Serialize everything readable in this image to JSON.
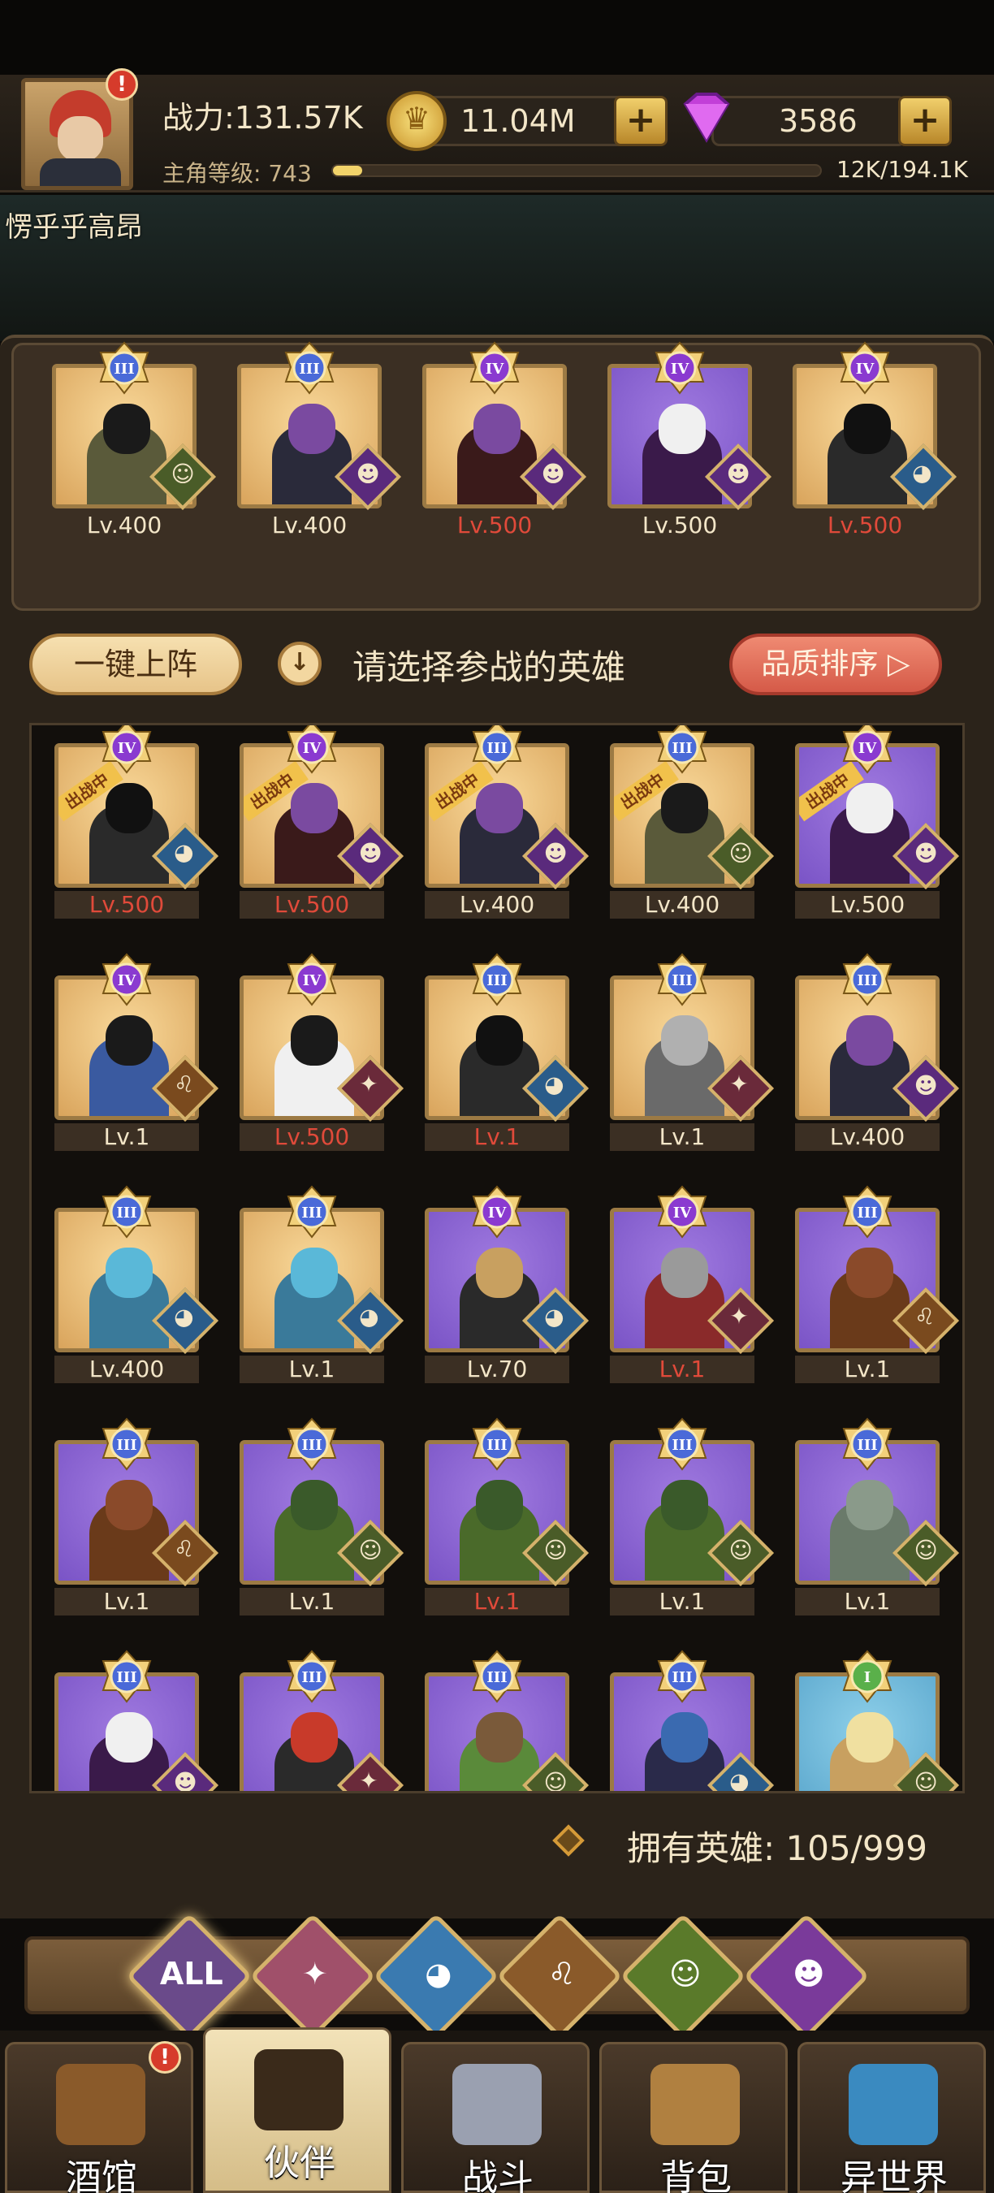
{
  "header": {
    "power_label": "战力:131.57K",
    "level_label": "主角等级:",
    "level_value": "743",
    "level_progress": 0.06,
    "exp_text": "12K/194.1K",
    "gold": "11.04M",
    "gems": "3586",
    "alert_badge": "!",
    "player_name": "愣乎乎高昂"
  },
  "team": [
    {
      "rank": "III",
      "level": "Lv.400",
      "level_red": false,
      "bg": "gold",
      "skin": "#1a1a1a",
      "body": "#5a5a3a",
      "faction": "el",
      "faction_icon": "☺"
    },
    {
      "rank": "III",
      "level": "Lv.400",
      "level_red": false,
      "bg": "gold",
      "skin": "#7a4aa0",
      "body": "#2a2a3a",
      "faction": "demon",
      "faction_icon": "☻"
    },
    {
      "rank": "IV",
      "level": "Lv.500",
      "level_red": true,
      "bg": "gold",
      "skin": "#7a4aa0",
      "body": "#3a1a1a",
      "faction": "demon",
      "faction_icon": "☻"
    },
    {
      "rank": "IV",
      "level": "Lv.500",
      "level_red": false,
      "bg": "purple",
      "skin": "#f0f0f0",
      "body": "#3a1a4a",
      "faction": "demon",
      "faction_icon": "☻"
    },
    {
      "rank": "IV",
      "level": "Lv.500",
      "level_red": true,
      "bg": "gold",
      "skin": "#111111",
      "body": "#2a2a2a",
      "faction": "fish",
      "faction_icon": "◕"
    }
  ],
  "controls": {
    "oneclick_label": "一键上阵",
    "info_icon": "↓",
    "prompt": "请选择参战的英雄",
    "sort_label": "品质排序 ▷"
  },
  "heroes": [
    {
      "rank": "IV",
      "level": "Lv.500",
      "level_red": true,
      "bg": "gold",
      "skin": "#111111",
      "body": "#2a2a2a",
      "faction": "fish",
      "faction_icon": "◕",
      "tag": "出战中"
    },
    {
      "rank": "IV",
      "level": "Lv.500",
      "level_red": true,
      "bg": "gold",
      "skin": "#7a4aa0",
      "body": "#3a1a1a",
      "faction": "demon",
      "faction_icon": "☻",
      "tag": "出战中"
    },
    {
      "rank": "III",
      "level": "Lv.400",
      "level_red": false,
      "bg": "gold",
      "skin": "#7a4aa0",
      "body": "#2a2a3a",
      "faction": "demon",
      "faction_icon": "☻",
      "tag": "出战中"
    },
    {
      "rank": "III",
      "level": "Lv.400",
      "level_red": false,
      "bg": "gold",
      "skin": "#1a1a1a",
      "body": "#5a5a3a",
      "faction": "el",
      "faction_icon": "☺",
      "tag": "出战中"
    },
    {
      "rank": "IV",
      "level": "Lv.500",
      "level_red": false,
      "bg": "purple",
      "skin": "#f0f0f0",
      "body": "#3a1a4a",
      "faction": "demon",
      "faction_icon": "☻",
      "tag": "出战中"
    },
    {
      "rank": "IV",
      "level": "Lv.1",
      "level_red": false,
      "bg": "gold",
      "skin": "#1a1a1a",
      "body": "#3a5aa0",
      "faction": "cat",
      "faction_icon": "♌",
      "tag": ""
    },
    {
      "rank": "IV",
      "level": "Lv.500",
      "level_red": true,
      "bg": "gold",
      "skin": "#1a1a1a",
      "body": "#f0f0f0",
      "faction": "cross",
      "faction_icon": "✦",
      "tag": ""
    },
    {
      "rank": "III",
      "level": "Lv.1",
      "level_red": true,
      "bg": "gold",
      "skin": "#111111",
      "body": "#2a2a2a",
      "faction": "fish",
      "faction_icon": "◕",
      "tag": ""
    },
    {
      "rank": "III",
      "level": "Lv.1",
      "level_red": false,
      "bg": "gold",
      "skin": "#b0b0b0",
      "body": "#6a6a6a",
      "faction": "cross",
      "faction_icon": "✦",
      "tag": ""
    },
    {
      "rank": "III",
      "level": "Lv.400",
      "level_red": false,
      "bg": "gold",
      "skin": "#7a4aa0",
      "body": "#2a2a3a",
      "faction": "demon",
      "faction_icon": "☻",
      "tag": ""
    },
    {
      "rank": "III",
      "level": "Lv.400",
      "level_red": false,
      "bg": "gold",
      "skin": "#5ab8d8",
      "body": "#3a7a9a",
      "faction": "fish",
      "faction_icon": "◕",
      "tag": ""
    },
    {
      "rank": "III",
      "level": "Lv.1",
      "level_red": false,
      "bg": "gold",
      "skin": "#5ab8d8",
      "body": "#3a7a9a",
      "faction": "fish",
      "faction_icon": "◕",
      "tag": ""
    },
    {
      "rank": "IV",
      "level": "Lv.70",
      "level_red": false,
      "bg": "purple",
      "skin": "#c8a060",
      "body": "#2a2a2a",
      "faction": "fish",
      "faction_icon": "◕",
      "tag": ""
    },
    {
      "rank": "IV",
      "level": "Lv.1",
      "level_red": true,
      "bg": "purple",
      "skin": "#9a9a9a",
      "body": "#8a2a2a",
      "faction": "cross",
      "faction_icon": "✦",
      "tag": ""
    },
    {
      "rank": "III",
      "level": "Lv.1",
      "level_red": false,
      "bg": "purple",
      "skin": "#8a4a2a",
      "body": "#6a3a1a",
      "faction": "cat",
      "faction_icon": "♌",
      "tag": ""
    },
    {
      "rank": "III",
      "level": "Lv.1",
      "level_red": false,
      "bg": "purple",
      "skin": "#8a4a2a",
      "body": "#6a3a1a",
      "faction": "cat",
      "faction_icon": "♌",
      "tag": ""
    },
    {
      "rank": "III",
      "level": "Lv.1",
      "level_red": false,
      "bg": "purple",
      "skin": "#3a5a2a",
      "body": "#4a6a2a",
      "faction": "el",
      "faction_icon": "☺",
      "tag": ""
    },
    {
      "rank": "III",
      "level": "Lv.1",
      "level_red": true,
      "bg": "purple",
      "skin": "#3a5a2a",
      "body": "#4a6a2a",
      "faction": "el",
      "faction_icon": "☺",
      "tag": ""
    },
    {
      "rank": "III",
      "level": "Lv.1",
      "level_red": false,
      "bg": "purple",
      "skin": "#3a5a2a",
      "body": "#4a6a2a",
      "faction": "el",
      "faction_icon": "☺",
      "tag": ""
    },
    {
      "rank": "III",
      "level": "Lv.1",
      "level_red": false,
      "bg": "purple",
      "skin": "#8a9a8a",
      "body": "#6a7a6a",
      "faction": "el",
      "faction_icon": "☺",
      "tag": ""
    },
    {
      "rank": "III",
      "level": "",
      "level_red": false,
      "bg": "purple",
      "skin": "#f0f0f0",
      "body": "#3a1a4a",
      "faction": "demon",
      "faction_icon": "☻",
      "tag": ""
    },
    {
      "rank": "III",
      "level": "",
      "level_red": false,
      "bg": "purple",
      "skin": "#c83a2a",
      "body": "#2a2a2a",
      "faction": "cross",
      "faction_icon": "✦",
      "tag": ""
    },
    {
      "rank": "III",
      "level": "",
      "level_red": false,
      "bg": "purple",
      "skin": "#7a5a3a",
      "body": "#5a8a3a",
      "faction": "el",
      "faction_icon": "☺",
      "tag": ""
    },
    {
      "rank": "III",
      "level": "",
      "level_red": false,
      "bg": "purple",
      "skin": "#3a6ab0",
      "body": "#2a2a4a",
      "faction": "fish",
      "faction_icon": "◕",
      "tag": ""
    },
    {
      "rank": "I",
      "level": "",
      "level_red": false,
      "bg": "blue",
      "skin": "#f0e0a0",
      "body": "#c8a060",
      "faction": "el",
      "faction_icon": "☺",
      "tag": ""
    }
  ],
  "owned": {
    "label": "拥有英雄:",
    "value": "105/999"
  },
  "filters": [
    {
      "name": "all",
      "label": "ALL",
      "color": "#6a4a8a"
    },
    {
      "name": "cross",
      "label": "✦",
      "color": "#a0506a"
    },
    {
      "name": "fish",
      "label": "◕",
      "color": "#3a7ab0"
    },
    {
      "name": "cat",
      "label": "♌",
      "color": "#8a5a2a"
    },
    {
      "name": "elf",
      "label": "☺",
      "color": "#5a7a2a"
    },
    {
      "name": "demon",
      "label": "☻",
      "color": "#7a3a9a"
    }
  ],
  "nav": [
    {
      "label": "酒馆",
      "icon_color": "#8a5a2a",
      "alert": "!"
    },
    {
      "label": "伙伴",
      "icon_color": "#3a2a1a",
      "alert": ""
    },
    {
      "label": "战斗",
      "icon_color": "#9aa0b0",
      "alert": ""
    },
    {
      "label": "背包",
      "icon_color": "#b08040",
      "alert": ""
    },
    {
      "label": "异世界",
      "icon_color": "#3a8ac0",
      "alert": ""
    }
  ],
  "rank_colors": {
    "I": "#5ab04a",
    "III": "#4a6ad8",
    "IV": "#8a3ad0"
  }
}
